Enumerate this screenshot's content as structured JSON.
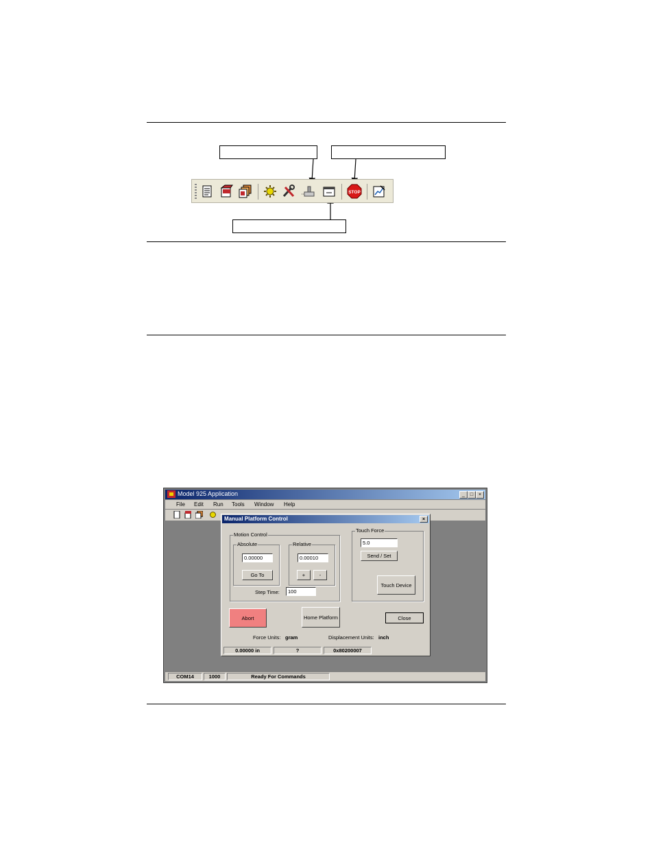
{
  "callouts": {
    "top_left": "",
    "top_right": "",
    "bottom": ""
  },
  "toolbar_icons": [
    "notepad-icon",
    "book-icon",
    "stack-icon",
    "gear-sun-icon",
    "tools-icon",
    "platform-icon",
    "window-icon",
    "stop-icon",
    "chart-icon"
  ],
  "app": {
    "title": "Model 925 Application",
    "menu": [
      "File",
      "Edit",
      "Run",
      "Tools",
      "Window",
      "Help"
    ],
    "status": {
      "port": "COM14",
      "count": "1000",
      "message": "Ready For Commands"
    }
  },
  "dialog": {
    "title": "Manual Platform Control",
    "motion_control": {
      "label": "Motion Control",
      "absolute": {
        "label": "Absolute",
        "value": "0.00000",
        "goto_label": "Go To"
      },
      "relative": {
        "label": "Relative",
        "value": "0.00010",
        "plus": "+",
        "minus": "-"
      },
      "step_time_label": "Step Time:",
      "step_time_value": "100"
    },
    "touch_force": {
      "label": "Touch Force",
      "value": "5.0",
      "send_label": "Send / Set",
      "touch_label": "Touch Device"
    },
    "abort_label": "Abort",
    "home_label": "Home Platform",
    "close_label": "Close",
    "force_units_label": "Force Units:",
    "force_units_value": "gram",
    "disp_units_label": "Displacement Units:",
    "disp_units_value": "inch",
    "status": {
      "position": "0.00000 in",
      "state": "?",
      "code": "0x80200007"
    },
    "abort_color": "#f08080"
  }
}
